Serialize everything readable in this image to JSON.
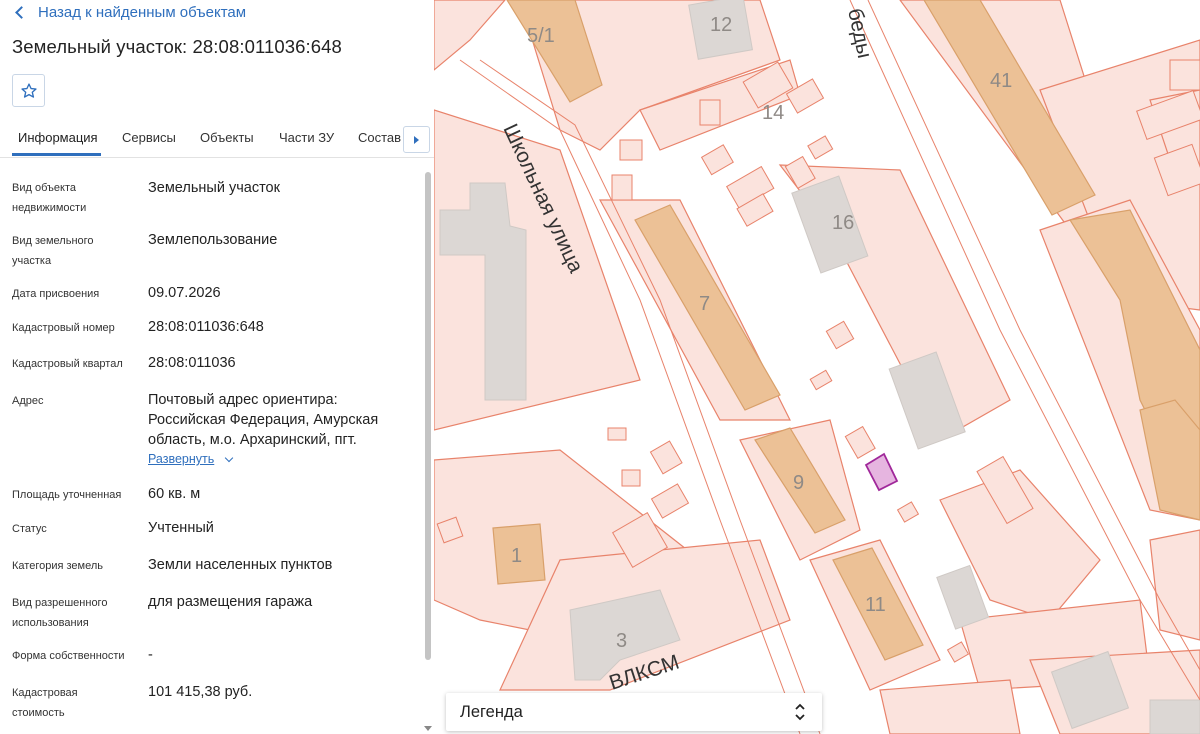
{
  "header": {
    "back_link": "Назад к найденным объектам",
    "title": "Земельный участок: 28:08:011036:648"
  },
  "tabs": [
    {
      "label": "Информация",
      "active": true
    },
    {
      "label": "Сервисы",
      "active": false
    },
    {
      "label": "Объекты",
      "active": false
    },
    {
      "label": "Части ЗУ",
      "active": false
    },
    {
      "label": "Состав",
      "active": false
    }
  ],
  "info": {
    "object_type_label": "Вид объекта недвижимости",
    "object_type_value": "Земельный участок",
    "plot_type_label": "Вид земельного участка",
    "plot_type_value": "Землепользование",
    "date_label": "Дата присвоения",
    "date_value": "09.07.2026",
    "cad_number_label": "Кадастровый номер",
    "cad_number_value": "28:08:011036:648",
    "cad_quarter_label": "Кадастровый квартал",
    "cad_quarter_value": "28:08:011036",
    "address_label": "Адрес",
    "address_line1": "Почтовый адрес ориентира:",
    "address_line2": "Российская Федерация, Амурская",
    "address_line3": "область, м.о. Архаринский, пгт.",
    "expand_label": "Развернуть",
    "area_label": "Площадь уточненная",
    "area_value": "60 кв. м",
    "status_label": "Статус",
    "status_value": "Учтенный",
    "category_label": "Категория земель",
    "category_value": "Земли населенных пунктов",
    "permitted_use_label": "Вид разрешенного использования",
    "permitted_use_value": "для размещения гаража",
    "ownership_label": "Форма собственности",
    "ownership_value": "-",
    "cost_label": "Кадастровая стоимость",
    "cost_value": "101 415,38 руб."
  },
  "map": {
    "street_school": "Школьная улица",
    "street_vlksm": "ВЛКСМ",
    "street_pobedy": "беды",
    "building_numbers": [
      "5/1",
      "12",
      "41",
      "14",
      "16",
      "7",
      "9",
      "1",
      "11",
      "3"
    ]
  },
  "legend": {
    "label": "Легенда"
  },
  "colors": {
    "accent": "#2f6fbd",
    "parcel_fill": "#fbe3dd",
    "parcel_stroke": "#e8836b",
    "building_fill": "#ecc196",
    "building_stroke": "#d9a06a",
    "gray_building": "#dcd7d4",
    "selected_parcel": "#b02a9e"
  },
  "icons": {
    "back": "chevron-left-icon",
    "favorite": "star-outline-icon",
    "tabs_next": "caret-right-icon",
    "expand": "chevron-down-icon",
    "legend_toggle": "unfold-icon"
  }
}
